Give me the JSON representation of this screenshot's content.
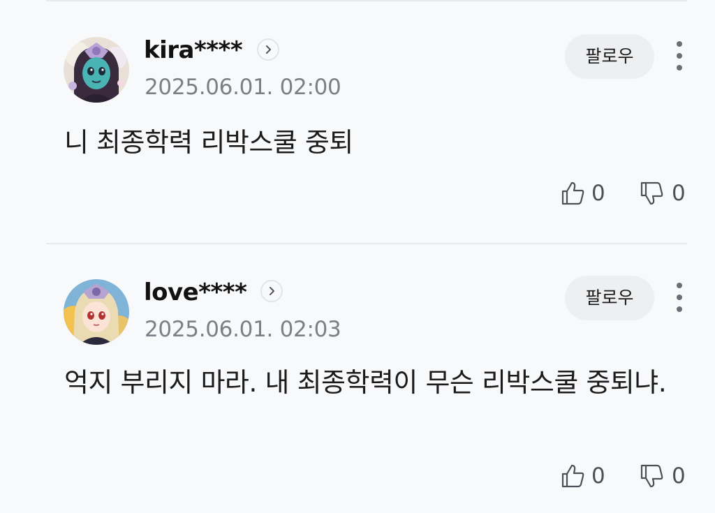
{
  "comments": [
    {
      "username": "kira****",
      "timestamp": "2025.06.01. 02:00",
      "follow_label": "팔로우",
      "text": "니 최종학력 리박스쿨 중퇴",
      "likes": "0",
      "dislikes": "0"
    },
    {
      "username": "love****",
      "timestamp": "2025.06.01. 02:03",
      "follow_label": "팔로우",
      "text": "억지 부리지 마라. 내 최종학력이 무슨 리박스쿨 중퇴냐.",
      "likes": "0",
      "dislikes": "0"
    }
  ],
  "icons": {
    "profile_arrow": "chevron-right-icon",
    "more": "more-vertical-icon",
    "like": "thumbs-up-icon",
    "dislike": "thumbs-down-icon"
  },
  "colors": {
    "background": "#f8f9fb",
    "follow_button_bg": "#eeeff1",
    "timestamp": "#7c7f86",
    "divider": "#e8e9ec"
  }
}
